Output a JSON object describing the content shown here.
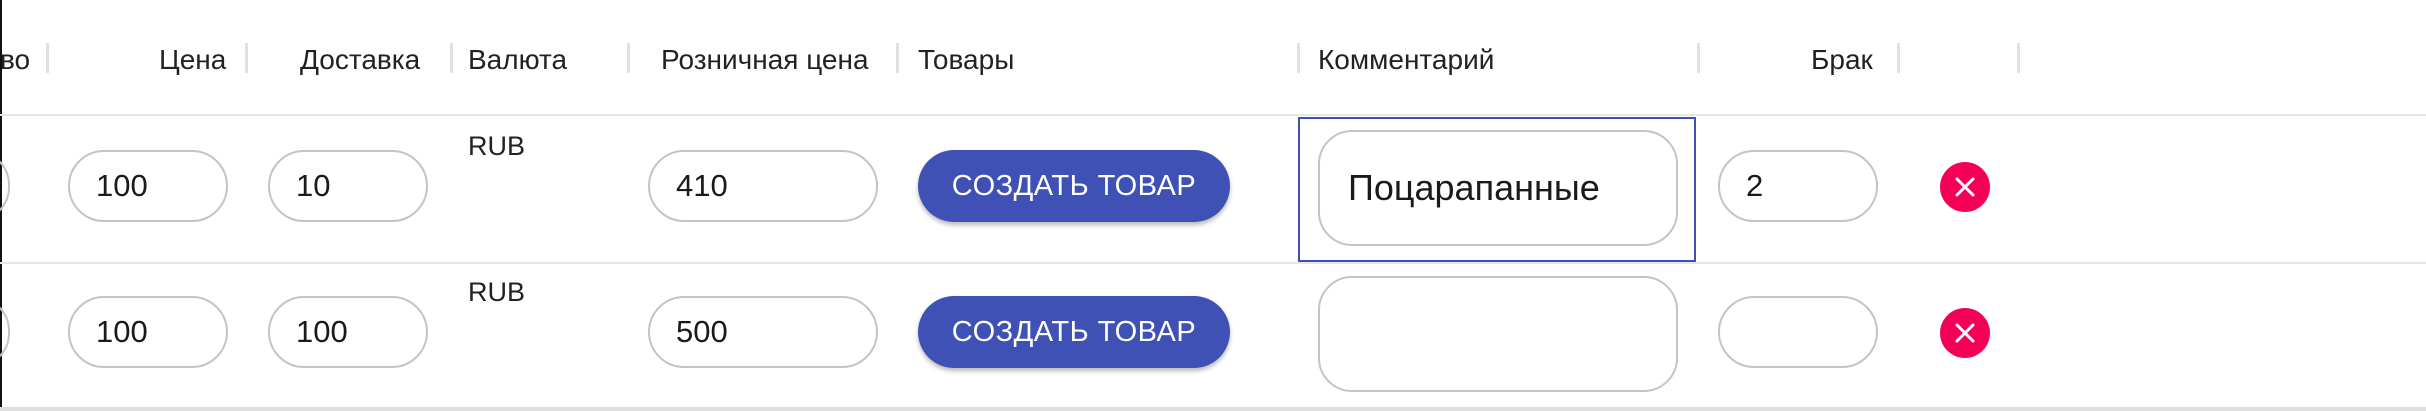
{
  "headers": {
    "quantity_partial": "во",
    "price": "Цена",
    "delivery": "Доставка",
    "currency": "Валюта",
    "retail_price": "Розничная цена",
    "products": "Товары",
    "comment": "Комментарий",
    "defect": "Брак"
  },
  "rows": [
    {
      "price": "100",
      "delivery": "10",
      "currency": "RUB",
      "retail_price": "410",
      "create_button": "СОЗДАТЬ ТОВАР",
      "comment": "Поцарапанные",
      "defect": "2",
      "delete_icon": "close-circle-icon"
    },
    {
      "price": "100",
      "delivery": "100",
      "currency": "RUB",
      "retail_price": "500",
      "create_button": "СОЗДАТЬ ТОВАР",
      "comment": "",
      "defect": "",
      "delete_icon": "close-circle-icon"
    }
  ],
  "colors": {
    "primary": "#3f51b5",
    "delete": "#f50057",
    "focus_border": "#3f51b5"
  }
}
